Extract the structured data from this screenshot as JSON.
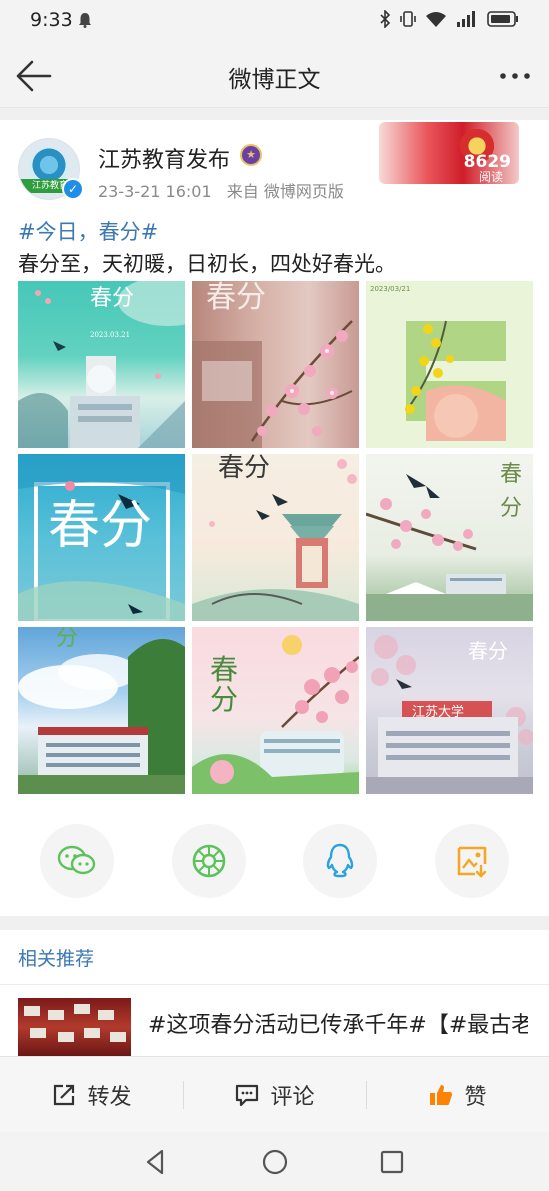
{
  "status_bar": {
    "time": "9:33"
  },
  "nav": {
    "title": "微博正文"
  },
  "post": {
    "author": "江苏教育发布",
    "avatar_label": "江苏教育",
    "timestamp": "23-3-21 16:01",
    "source": "来自 微博网页版",
    "read_count": "8629",
    "read_label": "阅读",
    "hashtag": "#今日，春分#",
    "body": "春分至，天初暖，日初长，四处好春光。",
    "images": [
      {
        "caption": "春分",
        "date": "2023.03.21"
      },
      {
        "caption": "春分"
      },
      {
        "caption": "春",
        "date": "2023/03/21"
      },
      {
        "caption": "春分"
      },
      {
        "caption": "春分"
      },
      {
        "caption": "春分"
      },
      {
        "caption": "分"
      },
      {
        "caption": "春分"
      },
      {
        "caption": "春分",
        "sign": "江苏大学"
      }
    ]
  },
  "share": [
    {
      "icon": "wechat-icon"
    },
    {
      "icon": "moments-icon"
    },
    {
      "icon": "qq-icon"
    },
    {
      "icon": "save-image-icon"
    }
  ],
  "related": {
    "title": "相关推荐",
    "item_text": "#这项春分活动已传承千年#【#最古老的春分药市在哪里#】赶分"
  },
  "actions": {
    "repost": "转发",
    "comment": "评论",
    "like": "赞"
  },
  "colors": {
    "link_blue": "#3c78b4",
    "like_orange": "#ff8200",
    "wechat_green": "#5cc35c",
    "qq_blue": "#2aa3dc",
    "save_orange": "#f5a623"
  }
}
